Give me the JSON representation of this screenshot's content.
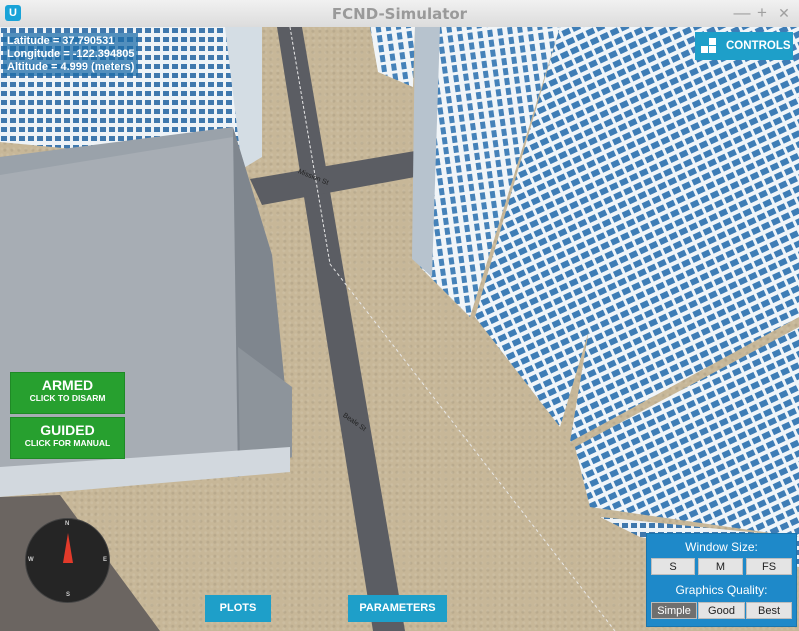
{
  "window": {
    "title": "FCND-Simulator",
    "minimize_glyph": "—",
    "maximize_glyph": "+",
    "close_glyph": "✕"
  },
  "telemetry": {
    "latitude": "Latitude = 37.790531",
    "longitude": "Longitude = -122.394805",
    "altitude": "Altitude = 4.999 (meters)"
  },
  "controls_button": {
    "label": "CONTROLS"
  },
  "status": {
    "armed_title": "ARMED",
    "armed_sub": "CLICK TO DISARM",
    "guided_title": "GUIDED",
    "guided_sub": "CLICK FOR MANUAL"
  },
  "compass": {
    "n": "N",
    "s": "S",
    "e": "E",
    "w": "W"
  },
  "streets": {
    "top": "Mission St",
    "mid": "Beale St"
  },
  "bottom": {
    "plots": "PLOTS",
    "parameters": "PARAMETERS"
  },
  "settings": {
    "window_size_label": "Window Size:",
    "sizes": [
      "S",
      "M",
      "FS"
    ],
    "selected_size": "M",
    "quality_label": "Graphics Quality:",
    "qualities": [
      "Simple",
      "Good",
      "Best"
    ],
    "selected_quality": "Simple"
  },
  "colors": {
    "accent": "#1e9fc9",
    "armed": "#27a02f",
    "needle": "#e23a2a"
  }
}
